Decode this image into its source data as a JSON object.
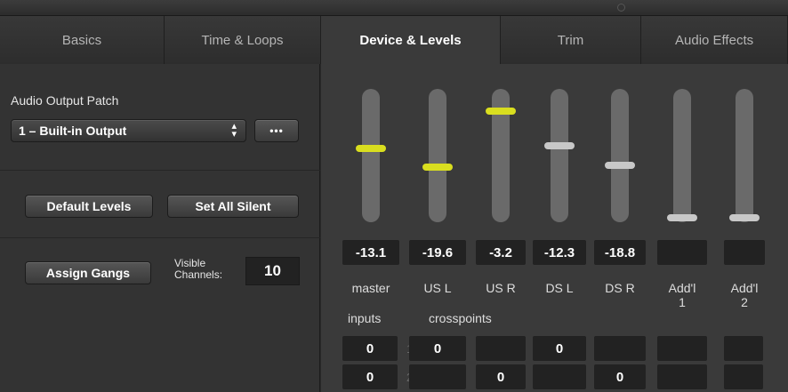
{
  "tabs": [
    {
      "label": "Basics",
      "active": false
    },
    {
      "label": "Time & Loops",
      "active": false
    },
    {
      "label": "Device & Levels",
      "active": true
    },
    {
      "label": "Trim",
      "active": false
    },
    {
      "label": "Audio Effects",
      "active": false
    }
  ],
  "left": {
    "output_patch_label": "Audio Output Patch",
    "output_patch_value": "1 – Built-in Output",
    "more_button": "•••",
    "default_levels": "Default Levels",
    "set_all_silent": "Set All Silent",
    "assign_gangs": "Assign Gangs",
    "visible_channels_label": "Visible Channels:",
    "visible_channels_value": "10"
  },
  "levels": {
    "knob_color_active": "#d9de1f",
    "knob_color_default": "#c8c8c8",
    "channels": [
      {
        "name": "master",
        "readout": "-13.1",
        "level": 0.56,
        "active": true
      },
      {
        "name": "US L",
        "readout": "-19.6",
        "level": 0.41,
        "active": true
      },
      {
        "name": "US R",
        "readout": "-3.2",
        "level": 0.86,
        "active": true
      },
      {
        "name": "DS L",
        "readout": "-12.3",
        "level": 0.58,
        "active": false
      },
      {
        "name": "DS R",
        "readout": "-18.8",
        "level": 0.42,
        "active": false
      },
      {
        "name": "Add'l\n1",
        "readout": "",
        "level": 0.0,
        "active": false
      },
      {
        "name": "Add'l\n2",
        "readout": "",
        "level": 0.0,
        "active": false
      }
    ]
  },
  "matrix": {
    "inputs_label": "inputs",
    "crosspoints_label": "crosspoints",
    "rows": [
      {
        "num": "1",
        "input": "0",
        "cells": [
          "0",
          "",
          "0",
          "",
          "",
          ""
        ]
      },
      {
        "num": "2",
        "input": "0",
        "cells": [
          "",
          "0",
          "",
          "0",
          "",
          ""
        ]
      }
    ]
  }
}
